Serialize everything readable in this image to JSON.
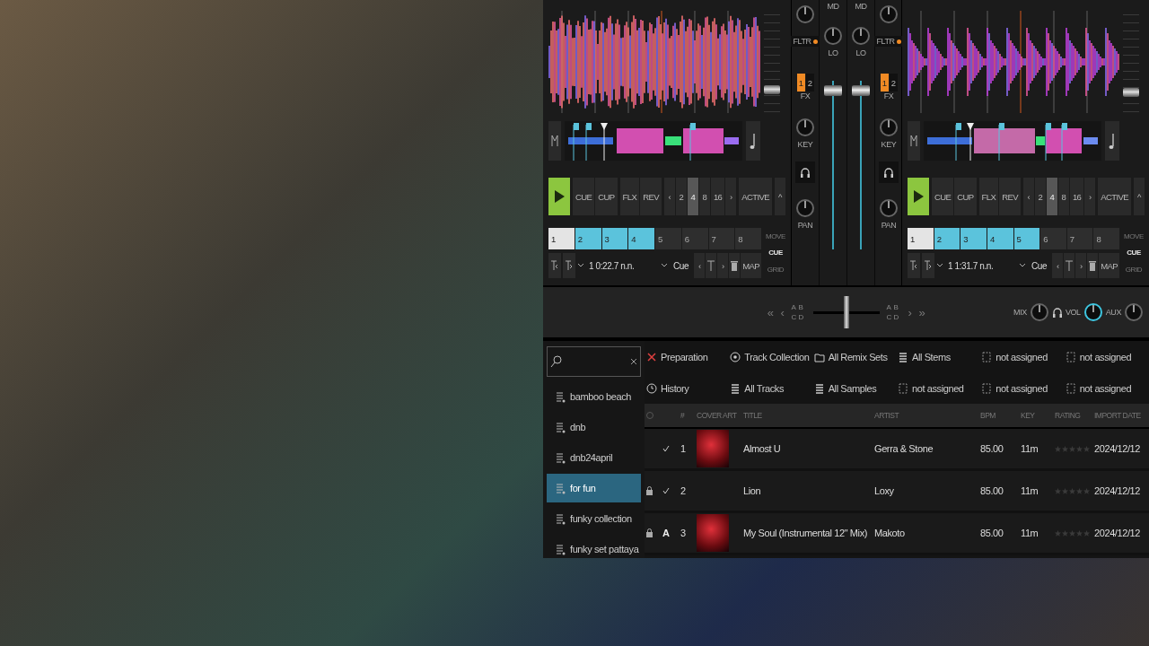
{
  "decks": [
    {
      "tempo": {
        "level": 0.22
      },
      "transport": [
        "CUE",
        "CUP",
        "FLX",
        "REV"
      ],
      "loop_prev": "‹",
      "loop_sizes": [
        {
          "label": "2",
          "selected": false
        },
        {
          "label": "4",
          "selected": true
        },
        {
          "label": "8",
          "selected": false
        },
        {
          "label": "16",
          "selected": false
        }
      ],
      "loop_next": "›",
      "loop_active": "ACTIVE",
      "collapse": "^",
      "hotcues": [
        {
          "label": "1",
          "color": "#e4e4e4"
        },
        {
          "label": "2",
          "color": "#5bc3dc"
        },
        {
          "label": "3",
          "color": "#5bc3dc"
        },
        {
          "label": "4",
          "color": "#5bc3dc"
        },
        {
          "label": "5",
          "color": "#2e2e2e"
        },
        {
          "label": "6",
          "color": "#2e2e2e"
        },
        {
          "label": "7",
          "color": "#2e2e2e"
        },
        {
          "label": "8",
          "color": "#2e2e2e"
        }
      ],
      "modes": [
        {
          "label": "MOVE",
          "selected": false
        },
        {
          "label": "CUE",
          "selected": true
        },
        {
          "label": "GRID",
          "selected": false
        }
      ],
      "position": "1 0:22.7 n.n.",
      "cue_type": "Cue",
      "cue_prev": "‹",
      "cue_next": "›",
      "map": "MAP"
    },
    {
      "tempo": {
        "level": 0.2
      },
      "transport": [
        "CUE",
        "CUP",
        "FLX",
        "REV"
      ],
      "loop_prev": "‹",
      "loop_sizes": [
        {
          "label": "2",
          "selected": false
        },
        {
          "label": "4",
          "selected": true
        },
        {
          "label": "8",
          "selected": false
        },
        {
          "label": "16",
          "selected": false
        }
      ],
      "loop_next": "›",
      "loop_active": "ACTIVE",
      "collapse": "^",
      "hotcues": [
        {
          "label": "1",
          "color": "#e4e4e4"
        },
        {
          "label": "2",
          "color": "#5bc3dc"
        },
        {
          "label": "3",
          "color": "#5bc3dc"
        },
        {
          "label": "4",
          "color": "#5bc3dc"
        },
        {
          "label": "5",
          "color": "#5bc3dc"
        },
        {
          "label": "6",
          "color": "#2e2e2e"
        },
        {
          "label": "7",
          "color": "#2e2e2e"
        },
        {
          "label": "8",
          "color": "#2e2e2e"
        }
      ],
      "modes": [
        {
          "label": "MOVE",
          "selected": false
        },
        {
          "label": "CUE",
          "selected": true
        },
        {
          "label": "GRID",
          "selected": false
        }
      ],
      "position": "1 1:31.7 n.n.",
      "cue_type": "Cue",
      "cue_prev": "‹",
      "cue_next": "›",
      "map": "MAP"
    }
  ],
  "mixer": {
    "channels": [
      {
        "filter": "FLTR",
        "mid": "MD",
        "low": "LO",
        "fx": "FX",
        "fx_units": [
          {
            "label": "1",
            "selected": true
          },
          {
            "label": "2",
            "selected": false
          }
        ],
        "key": "KEY",
        "pan": "PAN",
        "level": 0.97
      },
      {
        "filter": "FLTR",
        "mid": "MD",
        "low": "LO",
        "fx": "FX",
        "fx_units": [
          {
            "label": "1",
            "selected": true
          },
          {
            "label": "2",
            "selected": false
          }
        ],
        "key": "KEY",
        "pan": "PAN",
        "level": 0.97
      }
    ]
  },
  "crossfader": {
    "nav_left": [
      "«",
      "‹"
    ],
    "left_assign": [
      "A",
      "B",
      "C",
      "D"
    ],
    "level": 0.5,
    "right_assign": [
      "A",
      "B",
      "C",
      "D"
    ],
    "nav_right": [
      "›",
      "»"
    ]
  },
  "master": {
    "knobs": [
      {
        "label": "MIX",
        "active": false
      },
      {
        "label": "VOL",
        "active": true
      },
      {
        "label": "AUX",
        "active": false
      }
    ]
  },
  "browser": {
    "playlists": [
      {
        "label": "bamboo beach",
        "selected": false
      },
      {
        "label": "dnb",
        "selected": false
      },
      {
        "label": "dnb24april",
        "selected": false
      },
      {
        "label": "for fun",
        "selected": true
      },
      {
        "label": "funky collection",
        "selected": false
      },
      {
        "label": "funky set pattaya",
        "selected": false
      }
    ],
    "favorites": [
      {
        "label": "Preparation",
        "kind": "preparation"
      },
      {
        "label": "Track Collection",
        "kind": "collection"
      },
      {
        "label": "All Remix Sets",
        "kind": "folder"
      },
      {
        "label": "All Stems",
        "kind": "list"
      },
      {
        "label": "not assigned",
        "kind": "empty"
      },
      {
        "label": "not assigned",
        "kind": "empty"
      },
      {
        "label": "History",
        "kind": "history"
      },
      {
        "label": "All Tracks",
        "kind": "list"
      },
      {
        "label": "All Samples",
        "kind": "list"
      },
      {
        "label": "not assigned",
        "kind": "empty"
      },
      {
        "label": "not assigned",
        "kind": "empty"
      },
      {
        "label": "not assigned",
        "kind": "empty"
      }
    ],
    "table": {
      "columns": [
        "#",
        "COVER ART",
        "TITLE",
        "ARTIST",
        "BPM",
        "KEY",
        "RATING",
        "IMPORT DATE"
      ],
      "rows": [
        {
          "locked": false,
          "checked": true,
          "flag": "",
          "number": "1",
          "has_cover": true,
          "title": "Almost U",
          "artist": "Gerra & Stone",
          "bpm": "85.00",
          "key": "11m",
          "stars": 0,
          "import_date": "2024/12/12"
        },
        {
          "locked": true,
          "checked": true,
          "flag": "",
          "number": "2",
          "has_cover": false,
          "title": "Lion",
          "artist": "Loxy",
          "bpm": "85.00",
          "key": "11m",
          "stars": 0,
          "import_date": "2024/12/12"
        },
        {
          "locked": true,
          "checked": false,
          "flag": "A",
          "number": "3",
          "has_cover": true,
          "title": "My Soul (Instrumental 12\" Mix)",
          "artist": "Makoto",
          "bpm": "85.00",
          "key": "11m",
          "stars": 0,
          "import_date": "2024/12/12"
        }
      ]
    }
  }
}
